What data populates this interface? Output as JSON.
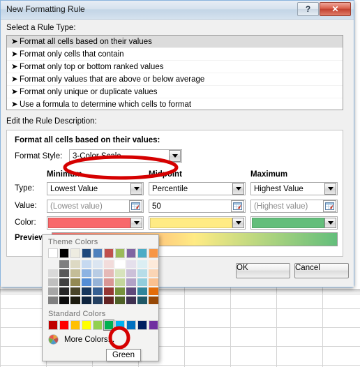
{
  "window": {
    "title": "New Formatting Rule",
    "help_button": "?",
    "close_button": "✕"
  },
  "rule_type": {
    "label": "Select a Rule Type:",
    "items": [
      {
        "label": "Format all cells based on their values",
        "selected": true
      },
      {
        "label": "Format only cells that contain",
        "selected": false
      },
      {
        "label": "Format only top or bottom ranked values",
        "selected": false
      },
      {
        "label": "Format only values that are above or below average",
        "selected": false
      },
      {
        "label": "Format only unique or duplicate values",
        "selected": false
      },
      {
        "label": "Use a formula to determine which cells to format",
        "selected": false
      }
    ]
  },
  "rule_description": {
    "label": "Edit the Rule Description:",
    "heading": "Format all cells based on their values:",
    "format_style_label": "Format Style:",
    "format_style_value": "3-Color Scale",
    "column_headers": [
      "Minimum",
      "Midpoint",
      "Maximum"
    ],
    "row_labels": {
      "type": "Type:",
      "value": "Value:",
      "color": "Color:"
    },
    "minimum": {
      "type": "Lowest Value",
      "value": "",
      "value_placeholder": "(Lowest value)",
      "color": "#F8696B"
    },
    "midpoint": {
      "type": "Percentile",
      "value": "50",
      "value_placeholder": "",
      "color": "#FFEB84"
    },
    "maximum": {
      "type": "Highest Value",
      "value": "",
      "value_placeholder": "(Highest value)",
      "color": "#63BE7B"
    },
    "preview_label": "Preview:",
    "preview_gradient": [
      "#F8696B",
      "#FFEB84",
      "#63BE7B"
    ]
  },
  "footer": {
    "ok": "OK",
    "cancel": "Cancel"
  },
  "color_picker": {
    "theme_label": "Theme Colors",
    "standard_label": "Standard Colors",
    "more_colors_label": "More Colors...",
    "theme_base": [
      "#FFFFFF",
      "#000000",
      "#EEECE1",
      "#1F497D",
      "#4F81BD",
      "#C0504D",
      "#9BBB59",
      "#8064A2",
      "#4BACC6",
      "#F79646"
    ],
    "theme_variants": [
      [
        "#F2F2F2",
        "#D9D9D9",
        "#BFBFBF",
        "#A6A6A6",
        "#808080"
      ],
      [
        "#7F7F7F",
        "#595959",
        "#404040",
        "#262626",
        "#0C0C0C"
      ],
      [
        "#DDD9C3",
        "#C4BD97",
        "#938953",
        "#494429",
        "#1D1B10"
      ],
      [
        "#C6D9F0",
        "#8DB3E2",
        "#538DD5",
        "#16365C",
        "#0F243E"
      ],
      [
        "#DBE5F1",
        "#B8CCE4",
        "#95B3D7",
        "#366092",
        "#244061"
      ],
      [
        "#F2DCDB",
        "#E5B9B7",
        "#D99694",
        "#953734",
        "#632423"
      ],
      [
        "#EBF1уде",
        "#D7E3BC",
        "#C3D69B",
        "#76923C",
        "#4F6128"
      ],
      [
        "#E5E0EC",
        "#CCC1D9",
        "#B2A2C7",
        "#5F497A",
        "#3F3151"
      ],
      [
        "#DBEEF3",
        "#B7DDE8",
        "#92CDDC",
        "#31859B",
        "#205867"
      ],
      [
        "#FDEADA",
        "#FBD5B5",
        "#FAC08F",
        "#E36C09",
        "#974806"
      ]
    ],
    "standard_colors": [
      "#C00000",
      "#FF0000",
      "#FFC000",
      "#FFFF00",
      "#92D050",
      "#00B050",
      "#00B0F0",
      "#0070C0",
      "#002060",
      "#7030A0"
    ],
    "selected_standard_index": 5,
    "tooltip": "Green"
  },
  "annotations": {
    "accent_color": "#D50000",
    "ellipse_format_style": "red ellipse around Format Style dropdown",
    "ellipse_green_swatch": "red ellipse around Green standard color swatch"
  }
}
